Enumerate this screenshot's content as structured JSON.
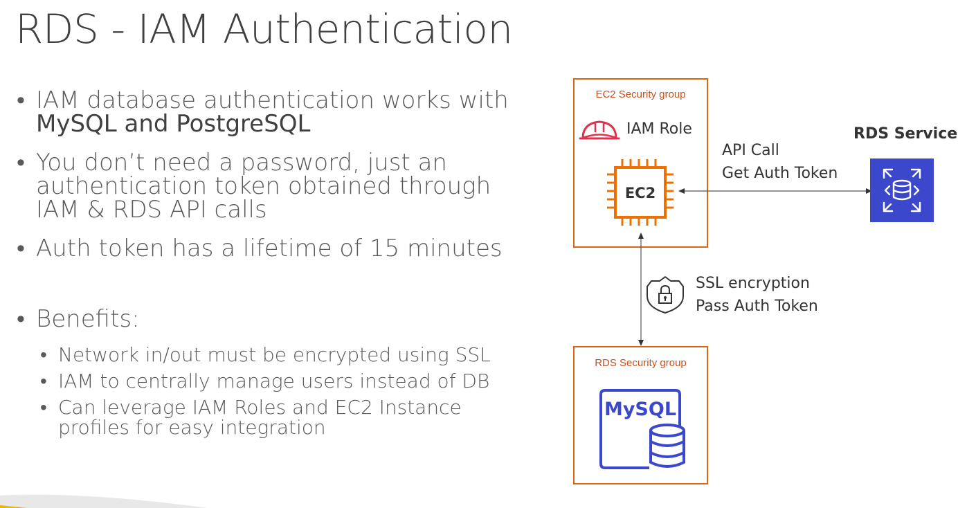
{
  "slide": {
    "title": "RDS - IAM Authentication",
    "bullets": [
      {
        "text": "IAM database authentication works with",
        "strong": "MySQL and PostgreSQL"
      },
      {
        "line1": "You don’t need a password, just an",
        "line2": "authentication token obtained through",
        "line3": "IAM & RDS API calls"
      },
      {
        "text": "Auth token has a lifetime of 15 minutes"
      },
      {
        "text": "Benefits:"
      }
    ],
    "benefits": [
      {
        "line1": "Network in/out must be encrypted using SSL"
      },
      {
        "line1": "IAM to centrally manage users instead of DB"
      },
      {
        "line1": "Can leverage IAM Roles and EC2 Instance",
        "line2": "profiles for easy integration"
      }
    ],
    "bullet_glyph": "•"
  },
  "diagram": {
    "ec2_group_label": "EC2 Security group",
    "iam_role_label": "IAM Role",
    "ec2_label": "EC2",
    "api_call_line1": "API Call",
    "api_call_line2": "Get Auth Token",
    "rds_service_label": "RDS Service",
    "ssl_line1": "SSL encryption",
    "ssl_line2": "Pass Auth Token",
    "rds_group_label": "RDS Security group",
    "mysql_label": "MySQL",
    "colors": {
      "security_group_border": "#d86613",
      "ec2_chip": "#ed7100",
      "iam_helmet": "#dd344c",
      "rds_service_bg": "#3b48cc",
      "mysql_icon": "#3b48cc"
    }
  }
}
